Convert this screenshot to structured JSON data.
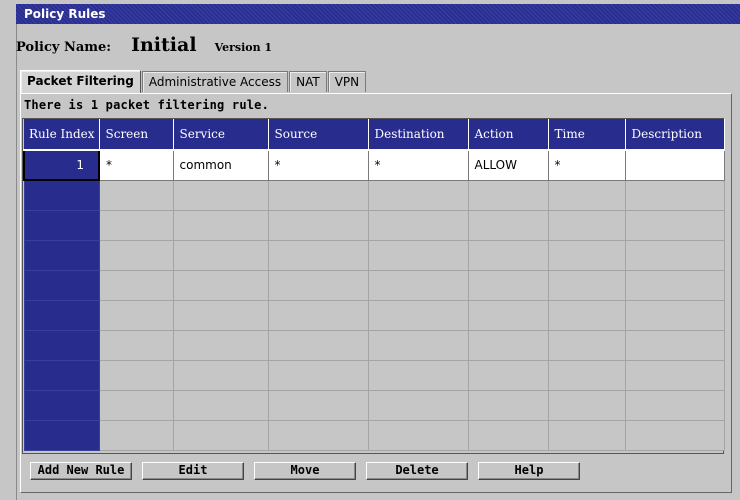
{
  "window": {
    "title": "Policy Rules"
  },
  "policy": {
    "name_label": "Policy Name:",
    "name_value": "Initial",
    "version": "Version 1"
  },
  "tabs": [
    {
      "label": "Packet Filtering",
      "active": true
    },
    {
      "label": "Administrative Access",
      "active": false
    },
    {
      "label": "NAT",
      "active": false
    },
    {
      "label": "VPN",
      "active": false
    }
  ],
  "rules_summary": "There is 1 packet filtering rule.",
  "table": {
    "columns": [
      "Rule Index",
      "Screen",
      "Service",
      "Source",
      "Destination",
      "Action",
      "Time",
      "Description"
    ],
    "rows": [
      [
        "1",
        "*",
        "common",
        "*",
        "*",
        "ALLOW",
        "*",
        ""
      ]
    ],
    "empty_rows": 9
  },
  "buttons": {
    "add": "Add New Rule",
    "edit": "Edit",
    "move": "Move",
    "delete": "Delete",
    "help": "Help"
  },
  "colors": {
    "header_bg": "#282c8c",
    "panel_bg": "#c6c6c6",
    "title_bg": "#2a2e8e"
  }
}
